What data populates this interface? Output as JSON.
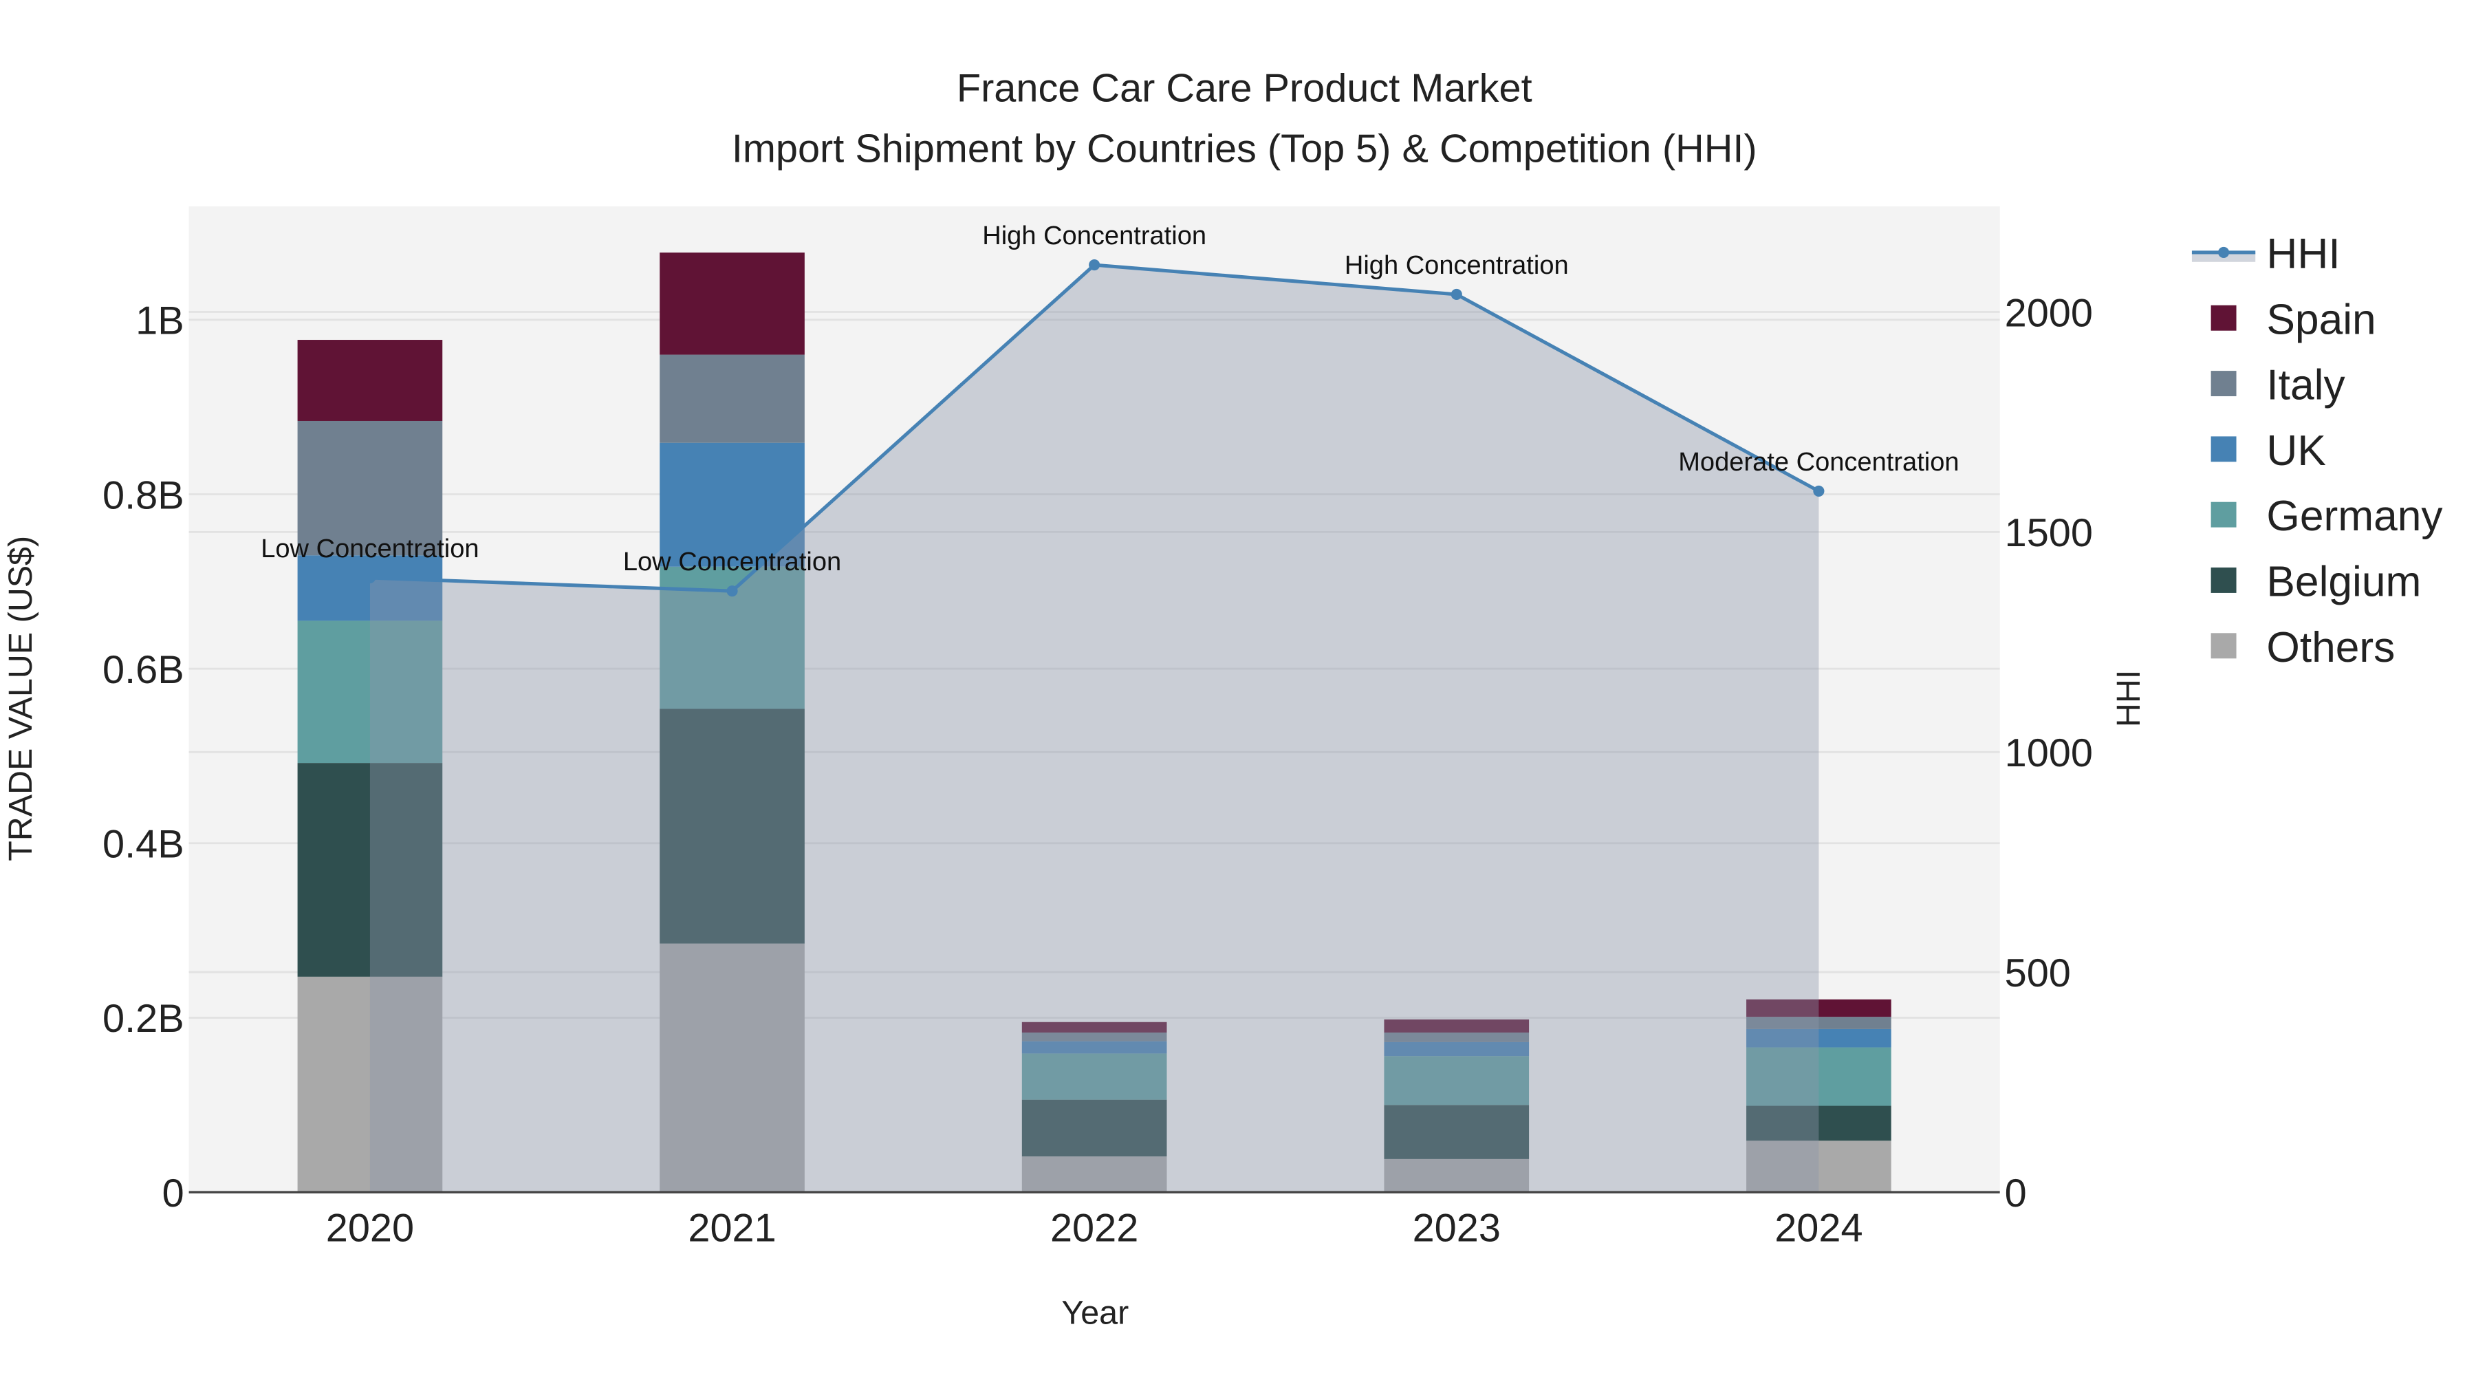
{
  "chart_data": {
    "type": "bar",
    "title": "France Car Care Product Market",
    "subtitle": "Import Shipment by Countries (Top 5) & Competition (HHI)",
    "xlabel": "Year",
    "ylabel": "TRADE VALUE (US$)",
    "y2label": "HHI",
    "categories": [
      "2020",
      "2021",
      "2022",
      "2023",
      "2024"
    ],
    "ylim": [
      0,
      1.13
    ],
    "y_ticks": [
      {
        "v": 0,
        "label": "0"
      },
      {
        "v": 0.2,
        "label": "0.2B"
      },
      {
        "v": 0.4,
        "label": "0.4B"
      },
      {
        "v": 0.6,
        "label": "0.6B"
      },
      {
        "v": 0.8,
        "label": "0.8B"
      },
      {
        "v": 1.0,
        "label": "1B"
      }
    ],
    "y2lim": [
      0,
      2240
    ],
    "y2_ticks": [
      {
        "v": 0,
        "label": "0"
      },
      {
        "v": 500,
        "label": "500"
      },
      {
        "v": 1000,
        "label": "1000"
      },
      {
        "v": 1500,
        "label": "1500"
      },
      {
        "v": 2000,
        "label": "2000"
      }
    ],
    "units": "billion US$",
    "stacked": true,
    "series": [
      {
        "name": "Others",
        "color": "#a9a9a9",
        "values": [
          0.247,
          0.285,
          0.041,
          0.038,
          0.059
        ]
      },
      {
        "name": "Belgium",
        "color": "#2f4f4f",
        "values": [
          0.245,
          0.269,
          0.065,
          0.062,
          0.04
        ]
      },
      {
        "name": "Germany",
        "color": "#5f9ea0",
        "values": [
          0.163,
          0.163,
          0.053,
          0.056,
          0.067
        ]
      },
      {
        "name": "UK",
        "color": "#4682b4",
        "values": [
          0.075,
          0.142,
          0.014,
          0.016,
          0.021
        ]
      },
      {
        "name": "Italy",
        "color": "#708090",
        "values": [
          0.154,
          0.101,
          0.01,
          0.011,
          0.014
        ]
      },
      {
        "name": "Spain",
        "color": "#601335",
        "values": [
          0.093,
          0.117,
          0.012,
          0.015,
          0.02
        ]
      }
    ],
    "hhi": {
      "name": "HHI",
      "color": "#4682b4",
      "values": [
        1396,
        1366,
        2107,
        2040,
        1593
      ],
      "labels": [
        "Low Concentration",
        "Low Concentration",
        "High Concentration",
        "High Concentration",
        "Moderate Concentration"
      ]
    },
    "legend_placement": "right",
    "legend": [
      "HHI",
      "Spain",
      "Italy",
      "UK",
      "Germany",
      "Belgium",
      "Others"
    ],
    "grid": true
  }
}
